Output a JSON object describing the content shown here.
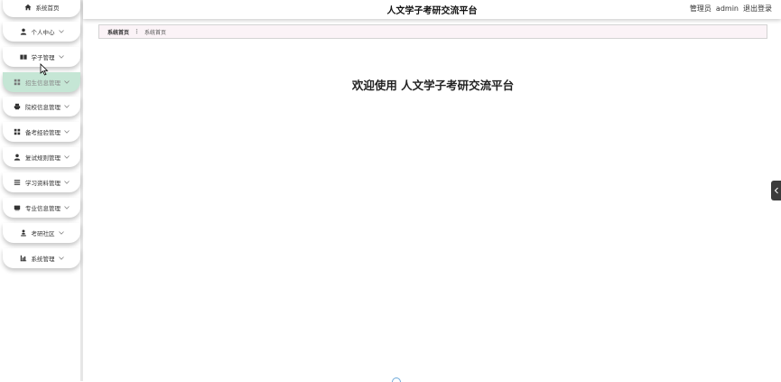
{
  "app": {
    "title": "人文学子考研交流平台"
  },
  "header": {
    "role": "管理员",
    "username": "admin",
    "logout_label": "退出登录"
  },
  "sidebar": {
    "items": [
      {
        "label": "系统首页",
        "icon": "home-icon",
        "has_chevron": false,
        "active": false
      },
      {
        "label": "个人中心",
        "icon": "user-icon",
        "has_chevron": true,
        "active": false
      },
      {
        "label": "学子管理",
        "icon": "book-icon",
        "has_chevron": true,
        "active": false
      },
      {
        "label": "招生信息管理",
        "icon": "grid-icon",
        "has_chevron": true,
        "active": true
      },
      {
        "label": "院校信息管理",
        "icon": "printer-icon",
        "has_chevron": true,
        "active": false
      },
      {
        "label": "备考经验管理",
        "icon": "grid-icon",
        "has_chevron": true,
        "active": false
      },
      {
        "label": "复试规则管理",
        "icon": "user-icon",
        "has_chevron": true,
        "active": false
      },
      {
        "label": "学习资料管理",
        "icon": "list-icon",
        "has_chevron": true,
        "active": false
      },
      {
        "label": "专业信息管理",
        "icon": "card-icon",
        "has_chevron": true,
        "active": false
      },
      {
        "label": "考研社区",
        "icon": "person-stand-icon",
        "has_chevron": true,
        "active": false
      },
      {
        "label": "系统管理",
        "icon": "chart-icon",
        "has_chevron": true,
        "active": false
      }
    ]
  },
  "breadcrumb": {
    "home": "系统首页",
    "separator": "⋮",
    "current": "系统首页"
  },
  "main": {
    "welcome": "欢迎使用 人文学子考研交流平台"
  },
  "colors": {
    "active_menu_bg": "#c5e6d5",
    "breadcrumb_bg": "#fbf3f7",
    "side_tab_bg": "#3b3b3b"
  }
}
